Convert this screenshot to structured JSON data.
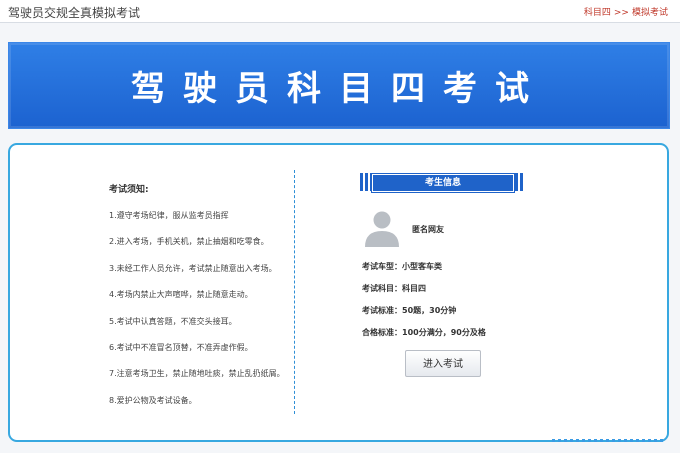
{
  "header": {
    "site_title": "驾驶员交规全真模拟考试",
    "breadcrumb": {
      "item1": "科目四",
      "separator": ">>",
      "item2": "模拟考试"
    }
  },
  "banner": {
    "title": "驾驶员科目四考试"
  },
  "notice": {
    "title": "考试须知:",
    "rules": [
      "1.遵守考场纪律，服从监考员指挥",
      "2.进入考场，手机关机，禁止抽烟和吃零食。",
      "3.未经工作人员允许，考试禁止随意出入考场。",
      "4.考场内禁止大声喧哗，禁止随意走动。",
      "5.考试中认真答题，不准交头接耳。",
      "6.考试中不准冒名顶替，不准弄虚作假。",
      "7.注意考场卫生，禁止随地吐痰，禁止乱扔纸屑。",
      "8.爱护公物及考试设备。"
    ]
  },
  "candidate": {
    "section_title": "考生信息",
    "avatar_icon": "user-silhouette-icon",
    "name": "匿名网友",
    "vehicle_type": "考试车型：小型客车类",
    "subject": "考试科目：科目四",
    "standard": "考试标准：50题，30分钟",
    "pass_criteria": "合格标准：100分满分，90分及格"
  },
  "actions": {
    "start_exam": "进入考试"
  },
  "colors": {
    "accent_blue": "#1f63c9",
    "panel_border": "#38a8e0",
    "link_red": "#c0392b"
  }
}
